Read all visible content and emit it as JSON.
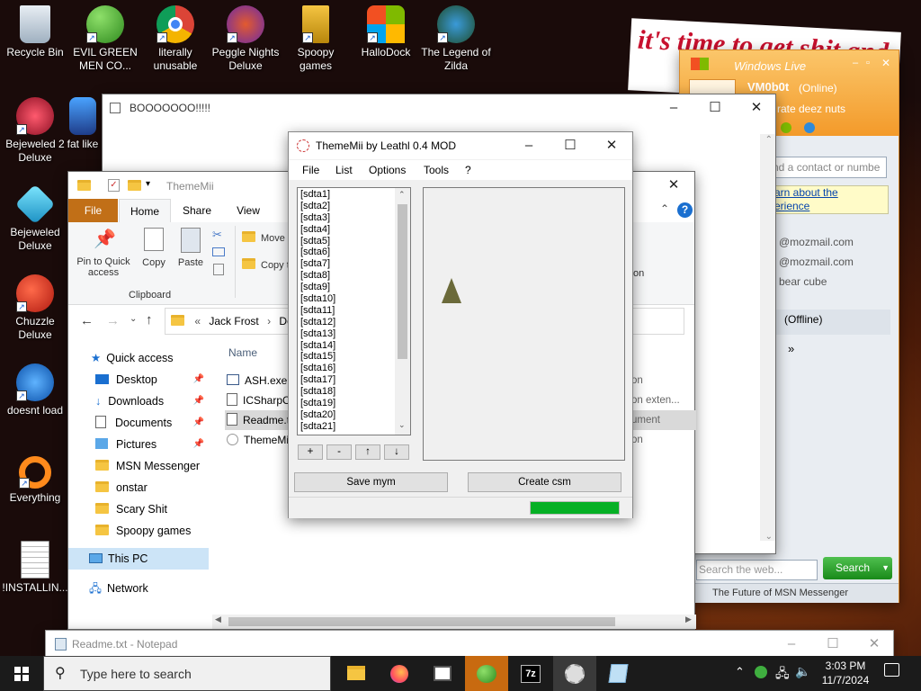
{
  "desktop_icons": [
    {
      "label": "Recycle Bin",
      "icon": "recycle-bin-icon"
    },
    {
      "label": "EVIL GREEN MEN CO...",
      "icon": "green-men-icon"
    },
    {
      "label": "literally unusable",
      "icon": "chrome-icon"
    },
    {
      "label": "Peggle Nights Deluxe",
      "icon": "peggle-icon"
    },
    {
      "label": "Spoopy games",
      "icon": "spoopy-folder-icon"
    },
    {
      "label": "HalloDock",
      "icon": "windows-logo-icon"
    },
    {
      "label": "The Legend of Zilda",
      "icon": "zilda-icon"
    },
    {
      "label": "Bejeweled 2 Deluxe",
      "icon": "bejeweled2-icon"
    },
    {
      "label": "fat like",
      "icon": "fat-like-icon"
    },
    {
      "label": "Bejeweled Deluxe",
      "icon": "bejeweled-icon"
    },
    {
      "label": "Chuzzle Deluxe",
      "icon": "chuzzle-icon"
    },
    {
      "label": "doesnt load",
      "icon": "thunderbird-icon"
    },
    {
      "label": "Everything",
      "icon": "everything-icon"
    },
    {
      "label": "!INSTALLIN...",
      "icon": "text-file-icon"
    }
  ],
  "wallpaper_text": "it's time to get shit and",
  "boo_window": {
    "title": "BOOOOOOO!!!!!"
  },
  "explorer": {
    "title": "ThemeMii",
    "ribbon_tabs": [
      "File",
      "Home",
      "Share",
      "View"
    ],
    "ribbon": {
      "pin_label": "Pin to Quick access",
      "copy_label": "Copy",
      "paste_label": "Paste",
      "move_label": "Move t",
      "copyto_label": "Copy t",
      "group_label": "Clipboard"
    },
    "address": {
      "part1": "Jack Frost",
      "part2": "Down"
    },
    "column_name": "Name",
    "nav_quick": "Quick access",
    "nav_items": [
      "Desktop",
      "Downloads",
      "Documents",
      "Pictures",
      "MSN Messenger",
      "onstar",
      "Scary Shit",
      "Spoopy games"
    ],
    "nav_thispc": "This PC",
    "nav_network": "Network",
    "files": [
      "ASH.exe",
      "ICSharpC",
      "Readme.t",
      "ThemeMi"
    ],
    "file_types": [
      "on",
      "on exten...",
      "ument",
      "on"
    ],
    "right_on": "on"
  },
  "thememii": {
    "title": "ThemeMii by Leathl 0.4 MOD",
    "menu": [
      "File",
      "List",
      "Options",
      "Tools",
      "?"
    ],
    "items": [
      "[sdta1]",
      "[sdta2]",
      "[sdta3]",
      "[sdta4]",
      "[sdta5]",
      "[sdta6]",
      "[sdta7]",
      "[sdta8]",
      "[sdta9]",
      "[sdta10]",
      "[sdta11]",
      "[sdta12]",
      "[sdta13]",
      "[sdta14]",
      "[sdta15]",
      "[sdta16]",
      "[sdta17]",
      "[sdta18]",
      "[sdta19]",
      "[sdta20]",
      "[sdta21]"
    ],
    "btn_add": "+",
    "btn_remove": "-",
    "btn_up": "↑",
    "btn_down": "↓",
    "save": "Save mym",
    "create": "Create csm",
    "progress": 1.0
  },
  "messenger": {
    "title": "Windows Live",
    "user": "VM0b0t",
    "status": "(Online)",
    "message": "rate deez nuts",
    "search_contact": "nd a contact or numbe",
    "learn_line1": "arn about the",
    "learn_line2": "erience",
    "emails": [
      "@mozmail.com",
      "@mozmail.com",
      "bear cube"
    ],
    "offline": "(Offline)",
    "more": "»",
    "web_search_placeholder": "Search the web...",
    "search_button": "Search",
    "footer": "The Future of MSN Messenger"
  },
  "notepad": {
    "title": "Readme.txt - Notepad"
  },
  "taskbar": {
    "search_placeholder": "Type here to search",
    "time": "3:03 PM",
    "date": "11/7/2024",
    "icons": [
      "file-explorer-icon",
      "firefox-icon",
      "news-icon",
      "msn-messenger-icon",
      "7zip-icon",
      "thememii-icon",
      "notepad-icon"
    ]
  },
  "colors": {
    "accent": "#0a63c9",
    "progress": "#06b025",
    "msn": "#f7a33c",
    "taskbar": "#1b1b1b"
  }
}
